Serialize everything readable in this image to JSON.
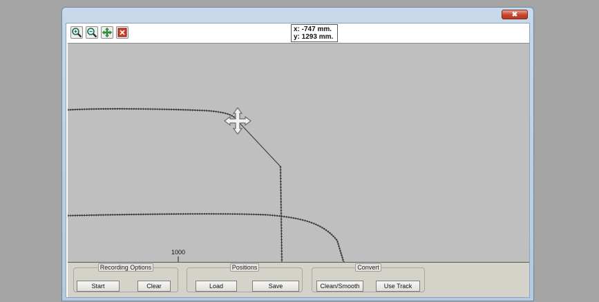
{
  "window": {
    "close_label": "✖"
  },
  "toolbar": {
    "tools": [
      {
        "icon": "zoom-in-icon"
      },
      {
        "icon": "zoom-out-icon"
      },
      {
        "icon": "pan-icon"
      },
      {
        "icon": "delete-icon"
      }
    ]
  },
  "coords": {
    "x_text": "x: -747 mm.",
    "y_text": "y: 1293 mm."
  },
  "plot": {
    "tick_label": "1000",
    "background_color": "#bfbfbf",
    "track_color": "#3a3a3a",
    "cursor_icon": "move-cursor-icon"
  },
  "groups": {
    "recording": {
      "legend": "Recording Options",
      "start_label": "Start",
      "clear_label": "Clear"
    },
    "positions": {
      "legend": "Positions",
      "load_label": "Load",
      "save_label": "Save"
    },
    "convert": {
      "legend": "Convert",
      "clean_label": "Clean/Smooth",
      "use_track_label": "Use Track"
    }
  }
}
